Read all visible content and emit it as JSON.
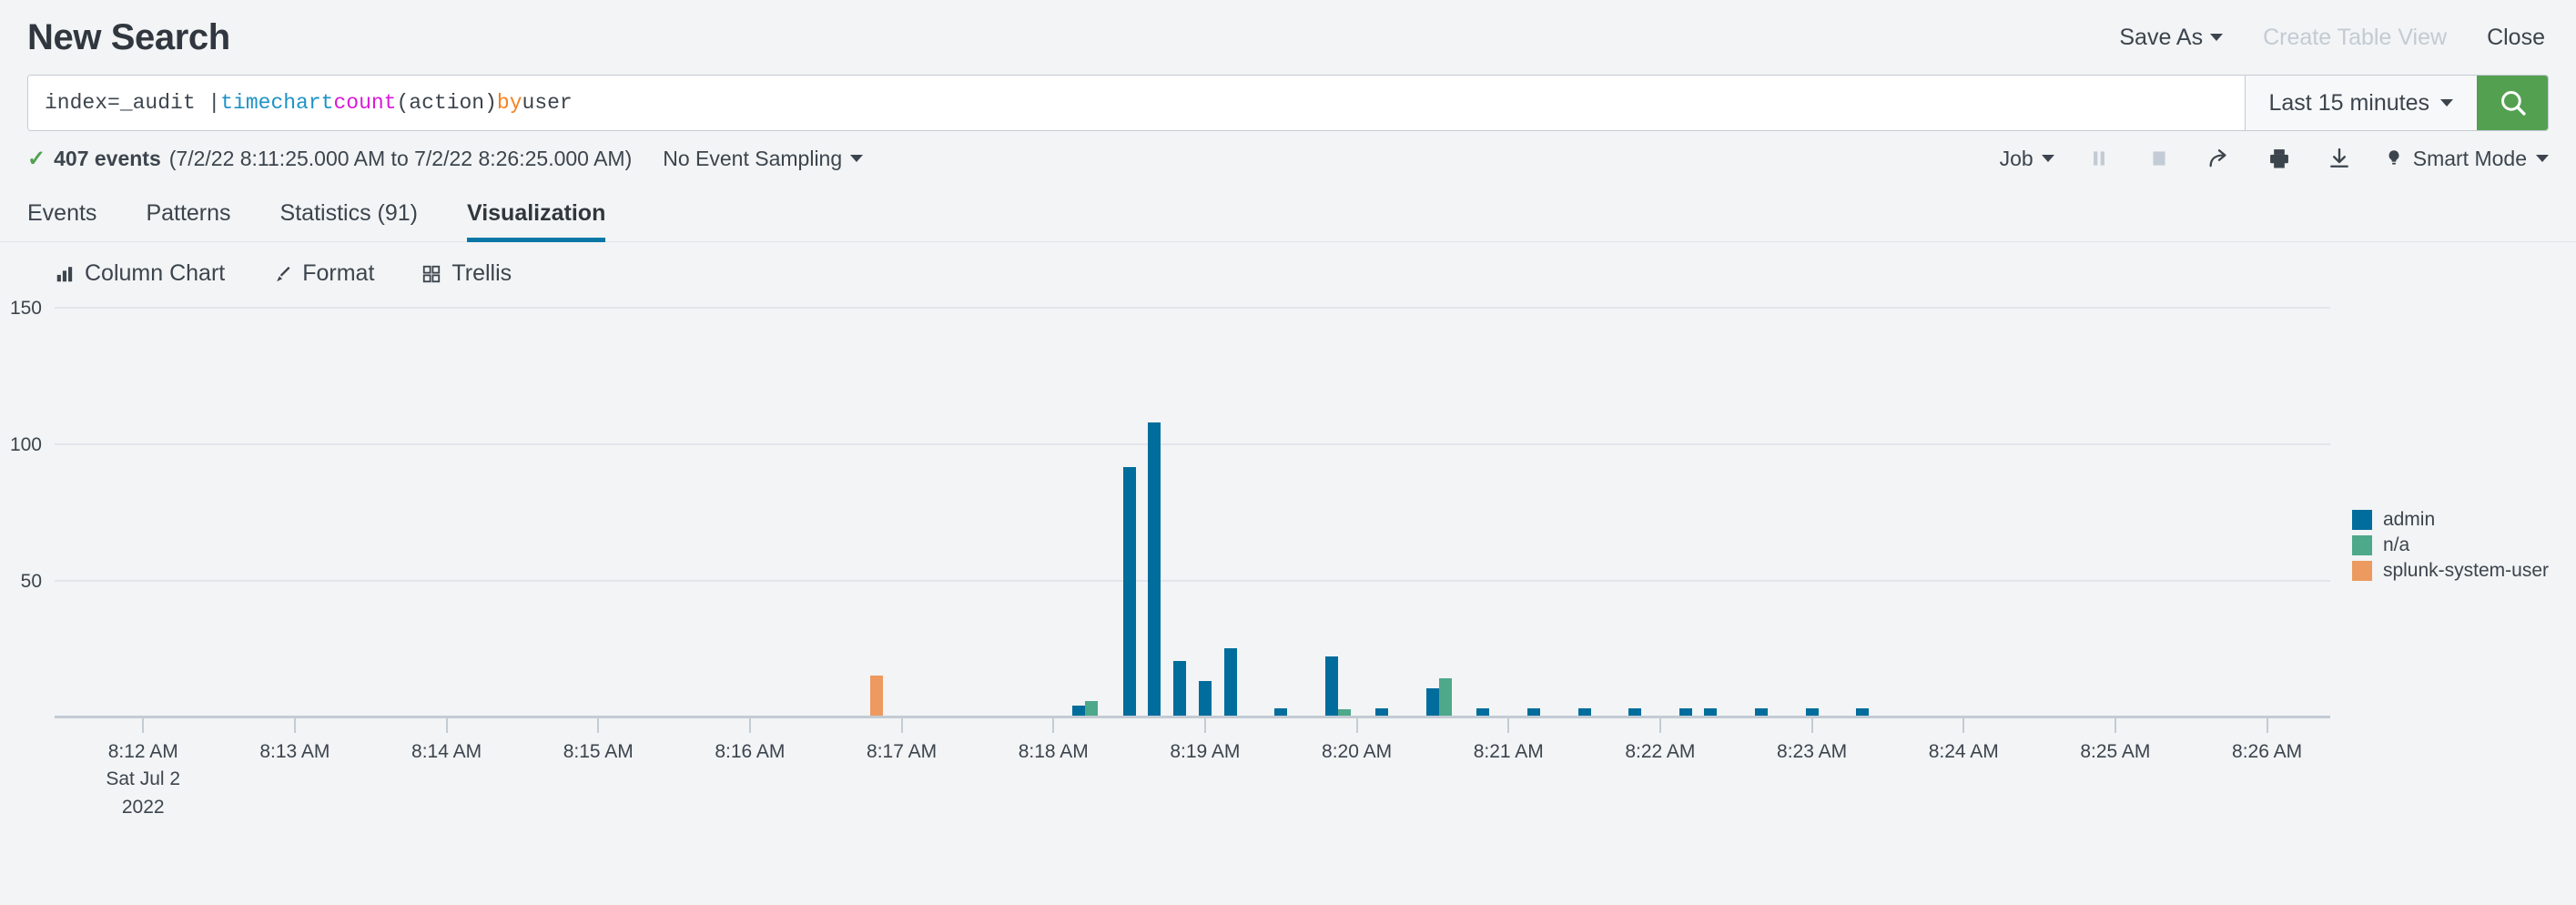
{
  "header": {
    "title": "New Search",
    "save_as_label": "Save As",
    "create_table_view_label": "Create Table View",
    "close_label": "Close"
  },
  "search": {
    "query_full": "index=_audit | timechart count(action) by user",
    "tokens": {
      "plain1": "index=_audit | ",
      "command": "timechart",
      "space1": " ",
      "function": "count",
      "paren": "(action) ",
      "keyword": "by",
      "plain2": " user"
    },
    "time_range_label": "Last 15 minutes",
    "search_icon": "search-icon"
  },
  "results": {
    "check_icon": "check-icon",
    "count_label": "407 events",
    "time_range": "(7/2/22 8:11:25.000 AM to 7/2/22 8:26:25.000 AM)",
    "sampling_label": "No Event Sampling",
    "job_label": "Job",
    "pause_icon": "pause-icon",
    "stop_icon": "stop-icon",
    "share_icon": "share-icon",
    "print_icon": "print-icon",
    "export_icon": "download-icon",
    "mode_icon": "lightbulb-icon",
    "mode_label": "Smart Mode"
  },
  "tabs": [
    {
      "label": "Events",
      "active": false
    },
    {
      "label": "Patterns",
      "active": false
    },
    {
      "label": "Statistics (91)",
      "active": false
    },
    {
      "label": "Visualization",
      "active": true
    }
  ],
  "chart_toolbar": [
    {
      "label": "Column Chart",
      "icon": "bar-chart-icon"
    },
    {
      "label": "Format",
      "icon": "paintbrush-icon"
    },
    {
      "label": "Trellis",
      "icon": "grid-icon"
    }
  ],
  "colors": {
    "admin": "#006d9c",
    "n/a": "#4ea88a",
    "splunk-system-user": "#ec9a60",
    "accent": "#0877a6",
    "search_button": "#53a051",
    "grid": "#e1e6eb",
    "axis": "#c3cbd4"
  },
  "chart_data": {
    "type": "bar",
    "title": "",
    "xlabel": "",
    "ylabel": "",
    "ylim": [
      0,
      150
    ],
    "yticks": [
      0,
      50,
      100,
      150
    ],
    "ytick_labels": [
      "",
      "50",
      "100",
      "150"
    ],
    "grid": true,
    "legend_position": "right",
    "x_axis_start": "8:11:25 AM",
    "x_axis_end": "8:26:25 AM",
    "x_tick_labels": [
      "8:12 AM",
      "8:13 AM",
      "8:14 AM",
      "8:15 AM",
      "8:16 AM",
      "8:17 AM",
      "8:18 AM",
      "8:19 AM",
      "8:20 AM",
      "8:21 AM",
      "8:22 AM",
      "8:23 AM",
      "8:24 AM",
      "8:25 AM",
      "8:26 AM"
    ],
    "x_first_tick_sublabels": [
      "Sat Jul 2",
      "2022"
    ],
    "legend": [
      "admin",
      "n/a",
      "splunk-system-user"
    ],
    "series": [
      {
        "name": "admin",
        "color": "#006d9c",
        "points": [
          {
            "t": "8:18:10",
            "v": 4
          },
          {
            "t": "8:18:30",
            "v": 100
          },
          {
            "t": "8:18:40",
            "v": 118
          },
          {
            "t": "8:18:50",
            "v": 22
          },
          {
            "t": "8:19:00",
            "v": 14
          },
          {
            "t": "8:19:10",
            "v": 27
          },
          {
            "t": "8:19:30",
            "v": 3
          },
          {
            "t": "8:19:50",
            "v": 24
          },
          {
            "t": "8:20:10",
            "v": 3
          },
          {
            "t": "8:20:30",
            "v": 11
          },
          {
            "t": "8:20:50",
            "v": 3
          },
          {
            "t": "8:21:10",
            "v": 3
          },
          {
            "t": "8:21:30",
            "v": 3
          },
          {
            "t": "8:21:50",
            "v": 3
          },
          {
            "t": "8:22:10",
            "v": 3
          },
          {
            "t": "8:22:20",
            "v": 3
          },
          {
            "t": "8:22:40",
            "v": 3
          },
          {
            "t": "8:23:00",
            "v": 3
          },
          {
            "t": "8:23:20",
            "v": 3
          }
        ]
      },
      {
        "name": "n/a",
        "color": "#4ea88a",
        "points": [
          {
            "t": "8:18:15",
            "v": 6
          },
          {
            "t": "8:19:55",
            "v": 2
          },
          {
            "t": "8:20:35",
            "v": 15
          }
        ]
      },
      {
        "name": "splunk-system-user",
        "color": "#ec9a60",
        "points": [
          {
            "t": "8:16:50",
            "v": 16
          }
        ]
      }
    ]
  }
}
